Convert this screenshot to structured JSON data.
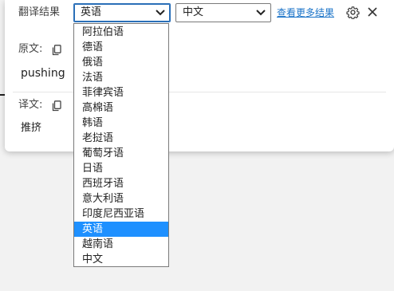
{
  "panel": {
    "title": "翻译结果",
    "source_select": {
      "value": "英语"
    },
    "target_select": {
      "value": "中文"
    },
    "more_link": "查看更多结果",
    "icons": {
      "settings": "gear-icon",
      "close": "close-icon",
      "copy": "copy-icon"
    }
  },
  "original": {
    "label": "原文:",
    "text": "pushing"
  },
  "translation": {
    "label": "译文:",
    "text": "推挤"
  },
  "dropdown": {
    "options": [
      "阿拉伯语",
      "德语",
      "俄语",
      "法语",
      "菲律宾语",
      "高棉语",
      "韩语",
      "老挝语",
      "葡萄牙语",
      "日语",
      "西班牙语",
      "意大利语",
      "印度尼西亚语",
      "英语",
      "越南语",
      "中文"
    ],
    "selected": "英语"
  },
  "colors": {
    "accent": "#1e90ff",
    "link": "#1a73c8",
    "focus_border": "#2a6fb8"
  }
}
